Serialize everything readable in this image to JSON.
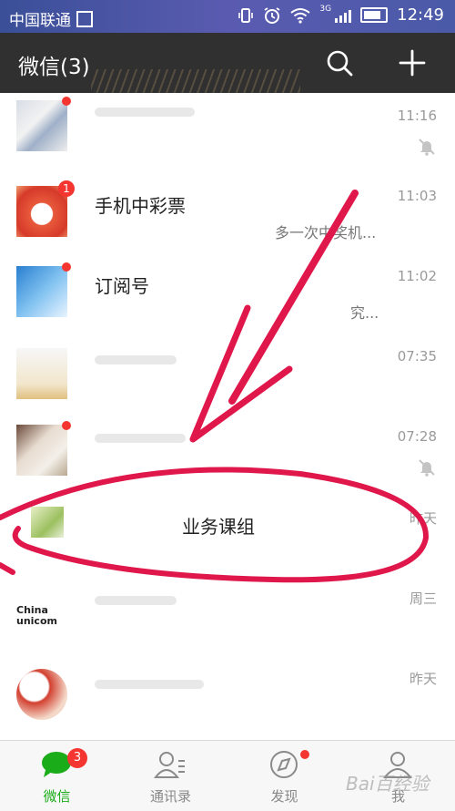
{
  "status_bar": {
    "carrier": "中国联通",
    "network": "3G",
    "time": "12:49"
  },
  "header": {
    "title": "微信(3)",
    "search_icon": "search-icon",
    "add_icon": "plus-icon"
  },
  "chats": [
    {
      "time": "11:16",
      "name": "",
      "preview": "",
      "muted": true,
      "badge": "",
      "dot": true
    },
    {
      "time": "11:03",
      "name": "手机中彩票",
      "preview": "多一次中奖机...",
      "muted": false,
      "badge": "1",
      "dot": false
    },
    {
      "time": "11:02",
      "name": "订阅号",
      "preview": "究...",
      "muted": false,
      "badge": "",
      "dot": true
    },
    {
      "time": "07:35",
      "name": "",
      "preview": "",
      "muted": false,
      "badge": "",
      "dot": false
    },
    {
      "time": "07:28",
      "name": "",
      "preview": "",
      "muted": true,
      "badge": "",
      "dot": true
    },
    {
      "time": "昨天",
      "name": "业务课组",
      "preview": "",
      "muted": false,
      "badge": "",
      "dot": false
    },
    {
      "time": "周三",
      "name": "",
      "preview": "",
      "muted": false,
      "badge": "",
      "dot": false,
      "avatar_text": "China unicom"
    },
    {
      "time": "昨天",
      "name": "",
      "preview": "",
      "muted": false,
      "badge": "",
      "dot": false
    }
  ],
  "tabs": [
    {
      "label": "微信",
      "icon": "chat-bubble-icon",
      "badge": "3",
      "active": true
    },
    {
      "label": "通讯录",
      "icon": "contacts-icon",
      "badge": "",
      "active": false
    },
    {
      "label": "发现",
      "icon": "compass-icon",
      "badge": "",
      "dot": true,
      "active": false
    },
    {
      "label": "我",
      "icon": "person-icon",
      "badge": "",
      "active": false
    }
  ],
  "colors": {
    "accent_green": "#1aad19",
    "badge_red": "#f43530",
    "header_bg": "#303030",
    "annotation_red": "#e0174a"
  }
}
